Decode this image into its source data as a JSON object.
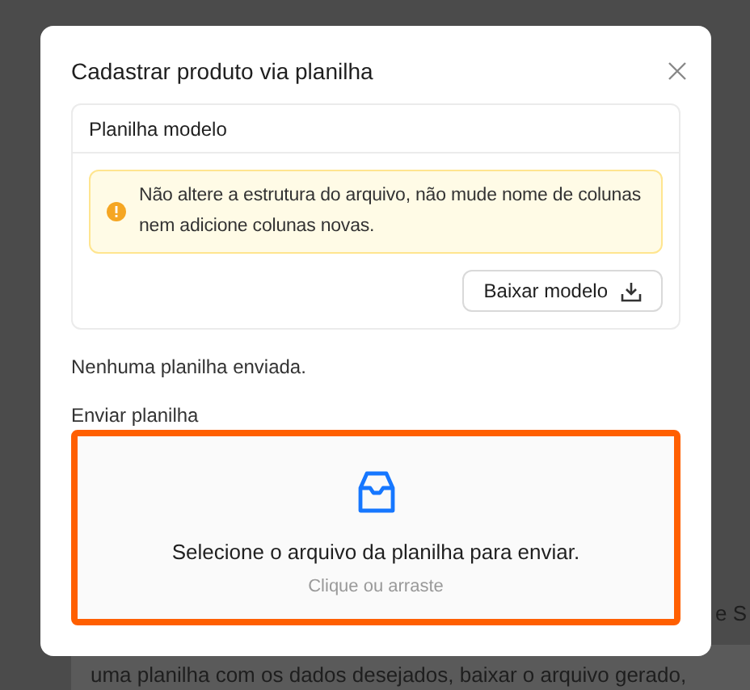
{
  "background_page": {
    "fragment_text": "e S",
    "panel_text": "uma planilha com os dados desejados, baixar o arquivo gerado,"
  },
  "modal": {
    "title": "Cadastrar produto via planilha",
    "template_card": {
      "title": "Planilha modelo",
      "warning": "Não altere a estrutura do arquivo, não mude nome de colunas nem adicione colunas novas.",
      "download_button": "Baixar modelo"
    },
    "status_text": "Nenhuma planilha enviada.",
    "upload": {
      "label": "Enviar planilha",
      "highlighted": true,
      "prompt": "Selecione o arquivo da planilha para enviar.",
      "hint": "Clique ou arraste"
    }
  }
}
